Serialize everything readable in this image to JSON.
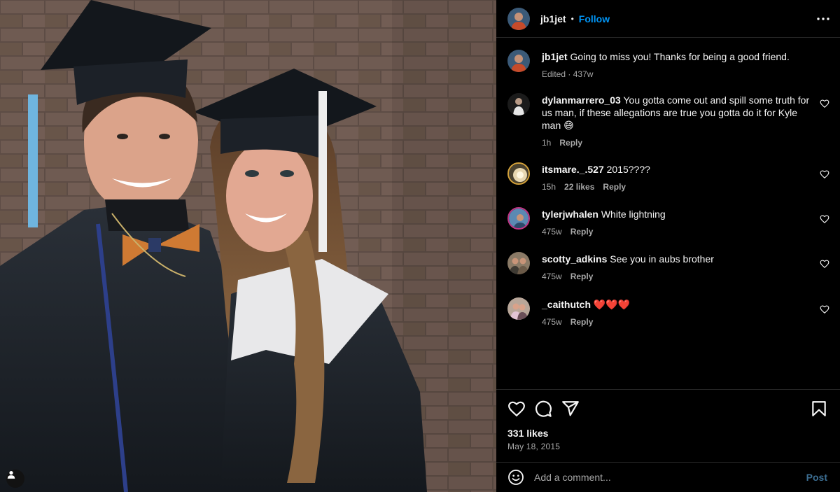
{
  "post": {
    "username": "jb1jet",
    "separator": "•",
    "follow_label": "Follow",
    "more_icon": "more-horizontal-icon",
    "caption": {
      "username": "jb1jet",
      "text": "Going to miss you! Thanks for being a good friend.",
      "meta": "Edited · 437w"
    },
    "comments": [
      {
        "username": "dylanmarrero_03",
        "text": "You gotta come out and spill some truth for us man, if these allegations are true you gotta do it for Kyle man 😅",
        "time": "1h",
        "likes": "",
        "reply": "Reply"
      },
      {
        "username": "itsmare._.527",
        "text": "2015????",
        "time": "15h",
        "likes": "22 likes",
        "reply": "Reply"
      },
      {
        "username": "tylerjwhalen",
        "text": "White lightning",
        "time": "475w",
        "likes": "",
        "reply": "Reply"
      },
      {
        "username": "scotty_adkins",
        "text": "See you in aubs brother",
        "time": "475w",
        "likes": "",
        "reply": "Reply"
      },
      {
        "username": "_caithutch",
        "text": "❤️❤️❤️",
        "time": "475w",
        "likes": "",
        "reply": "Reply"
      }
    ],
    "likes_count": "331 likes",
    "date": "May 18, 2015",
    "add_comment_placeholder": "Add a comment...",
    "post_label": "Post"
  },
  "colors": {
    "background": "#000000",
    "accent": "#0095f6",
    "muted": "#a8a8a8",
    "divider": "#262626"
  }
}
